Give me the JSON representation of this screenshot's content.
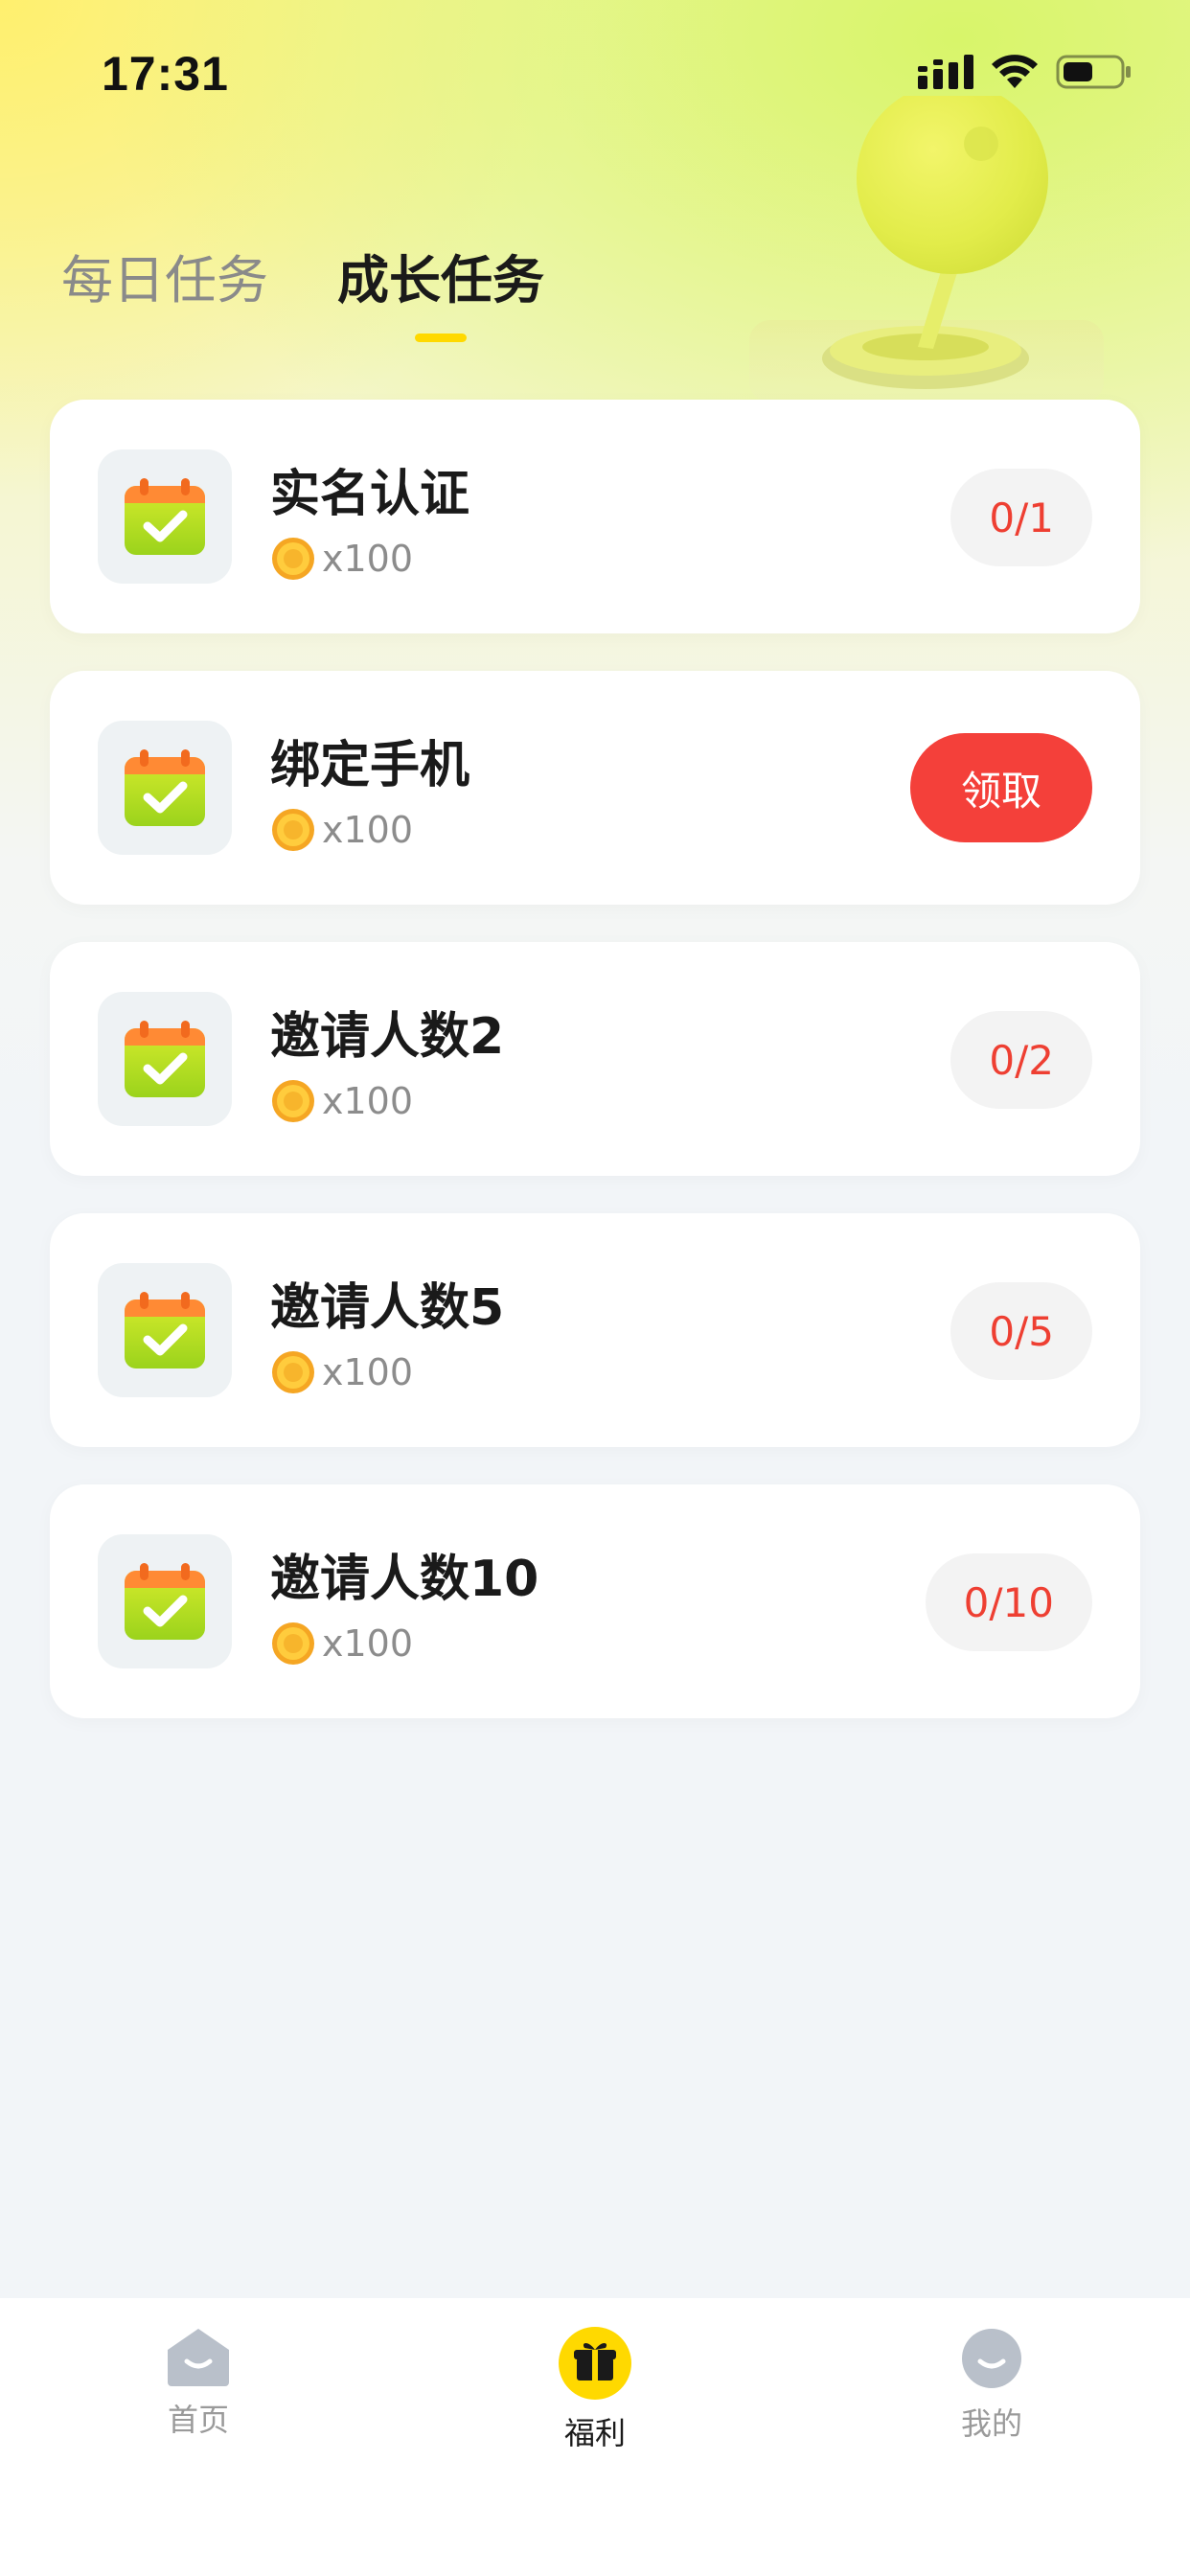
{
  "status_bar": {
    "time": "17:31"
  },
  "tabs": [
    {
      "label": "每日任务",
      "active": false
    },
    {
      "label": "成长任务",
      "active": true
    }
  ],
  "tasks": [
    {
      "title": "实名认证",
      "reward": "x100",
      "action": {
        "type": "progress",
        "label": "0/1"
      }
    },
    {
      "title": "绑定手机",
      "reward": "x100",
      "action": {
        "type": "claim",
        "label": "领取"
      }
    },
    {
      "title": "邀请人数2",
      "reward": "x100",
      "action": {
        "type": "progress",
        "label": "0/2"
      }
    },
    {
      "title": "邀请人数5",
      "reward": "x100",
      "action": {
        "type": "progress",
        "label": "0/5"
      }
    },
    {
      "title": "邀请人数10",
      "reward": "x100",
      "action": {
        "type": "progress",
        "label": "0/10"
      }
    }
  ],
  "bottom_nav": [
    {
      "label": "首页",
      "icon": "home-icon",
      "active": false
    },
    {
      "label": "福利",
      "icon": "gift-icon",
      "active": true
    },
    {
      "label": "我的",
      "icon": "profile-icon",
      "active": false
    }
  ],
  "colors": {
    "accent_yellow": "#FFD900",
    "claim_red": "#F4403A",
    "progress_red": "#EE3F32"
  }
}
